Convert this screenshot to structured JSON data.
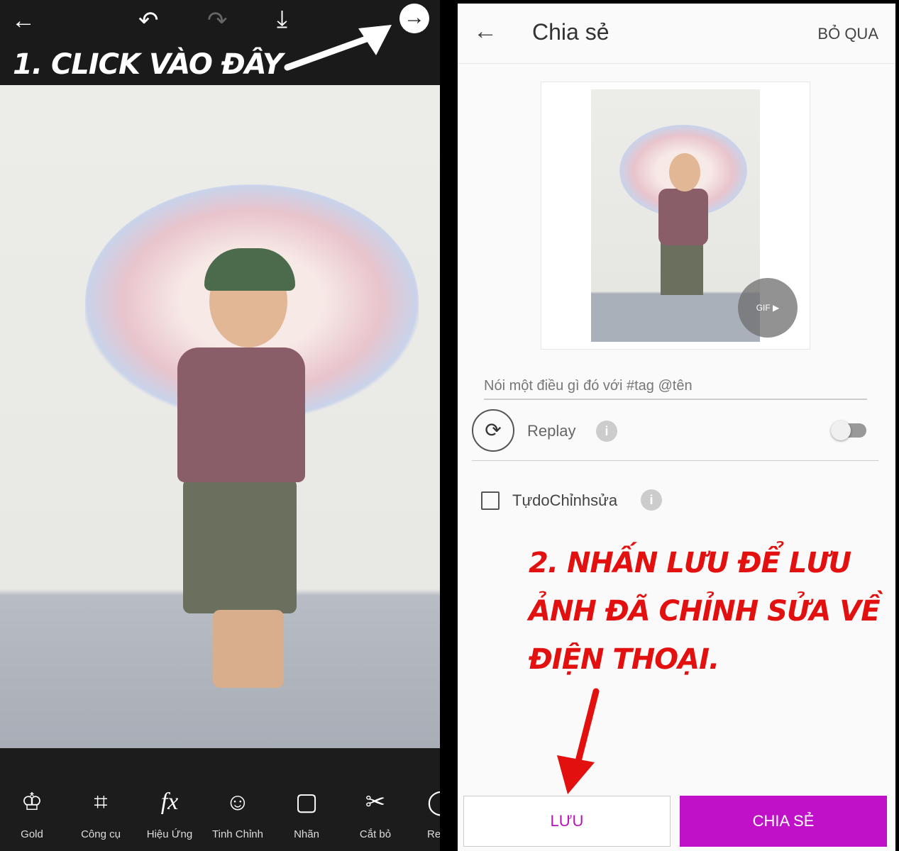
{
  "editor": {
    "top_icons": [
      "back-arrow-icon",
      "undo-icon",
      "redo-icon",
      "download-icon",
      "next-arrow-icon"
    ],
    "annotation": "1. Click vào đây",
    "tools": [
      {
        "label": "Gold",
        "icon": "crown-icon"
      },
      {
        "label": "Công cụ",
        "icon": "crop-icon"
      },
      {
        "label": "Hiệu Ứng",
        "icon": "fx-icon"
      },
      {
        "label": "Tinh Chỉnh",
        "icon": "face-retouch-icon"
      },
      {
        "label": "Nhãn",
        "icon": "sticker-icon"
      },
      {
        "label": "Cắt bỏ",
        "icon": "cutout-icon"
      },
      {
        "label": "Re",
        "icon": "circle-icon"
      }
    ]
  },
  "share": {
    "title": "Chia sẻ",
    "skip": "BỎ QUA",
    "gif_badge": "GIF",
    "caption_placeholder": "Nói một điều gì đó với #tag @tên",
    "replay_label": "Replay",
    "replay_enabled": false,
    "free_edit_label": "TựdoChỉnhsửa",
    "free_edit_checked": false,
    "annotation": "2. Nhấn lưu để lưu ảnh đã chỉnh sửa về điện thoại.",
    "save_label": "LƯU",
    "share_label": "CHIA SẺ",
    "accent": "#c010c8",
    "annotation_color": "#e31010"
  }
}
